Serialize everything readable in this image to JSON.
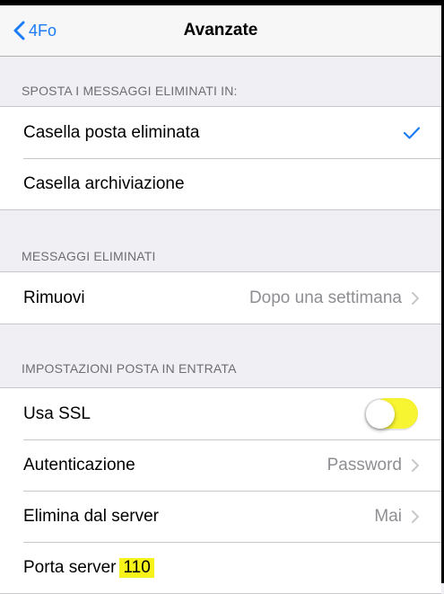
{
  "nav": {
    "back_label": "4Fo",
    "title": "Avanzate"
  },
  "sections": {
    "move_deleted": {
      "header": "SPOSTA I MESSAGGI ELIMINATI IN:",
      "items": [
        {
          "label": "Casella posta eliminata",
          "selected": true
        },
        {
          "label": "Casella archiviazione",
          "selected": false
        }
      ]
    },
    "deleted_messages": {
      "header": "MESSAGGI ELIMINATI",
      "remove": {
        "label": "Rimuovi",
        "value": "Dopo una settimana"
      }
    },
    "incoming": {
      "header": "IMPOSTAZIONI POSTA IN ENTRATA",
      "ssl": {
        "label": "Usa SSL",
        "enabled": false
      },
      "auth": {
        "label": "Autenticazione",
        "value": "Password"
      },
      "delete_server": {
        "label": "Elimina dal server",
        "value": "Mai"
      },
      "port": {
        "label": "Porta server",
        "value": "110"
      }
    }
  },
  "colors": {
    "accent": "#1a7cf6",
    "highlight": "#f6f31b",
    "background": "#efeff4"
  }
}
